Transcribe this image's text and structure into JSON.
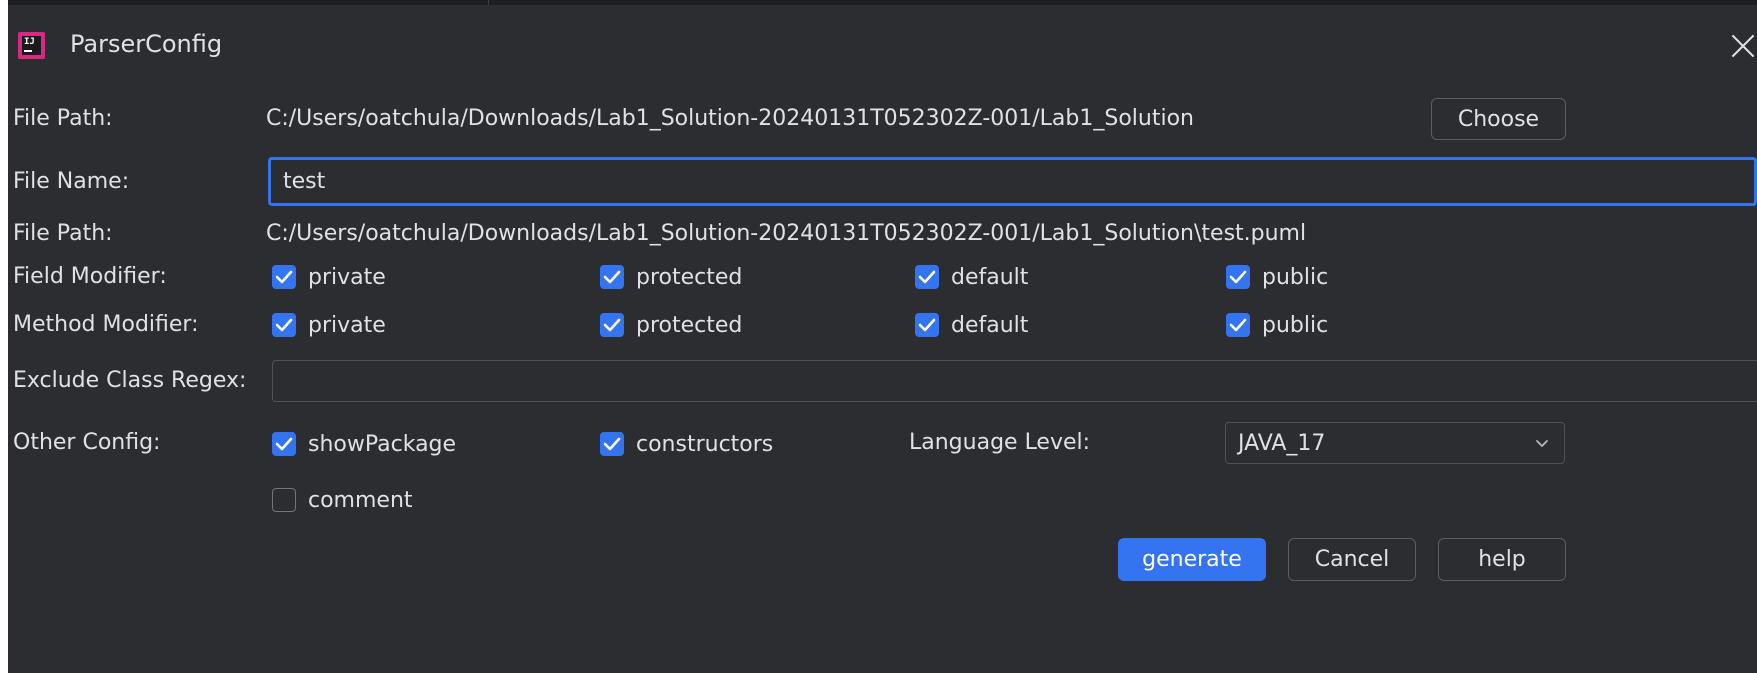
{
  "window": {
    "title": "ParserConfig"
  },
  "form": {
    "file_path_label": "File Path:",
    "file_path_value": "C:/Users/oatchula/Downloads/Lab1_Solution-20240131T052302Z-001/Lab1_Solution",
    "choose_label": "Choose",
    "file_name_label": "File Name:",
    "file_name_value": "test",
    "output_path_label": "File Path:",
    "output_path_value": "C:/Users/oatchula/Downloads/Lab1_Solution-20240131T052302Z-001/Lab1_Solution\\test.puml",
    "field_modifier_label": "Field Modifier:",
    "field_modifiers": [
      {
        "label": "private",
        "checked": true
      },
      {
        "label": "protected",
        "checked": true
      },
      {
        "label": "default",
        "checked": true
      },
      {
        "label": "public",
        "checked": true
      }
    ],
    "method_modifier_label": "Method Modifier:",
    "method_modifiers": [
      {
        "label": "private",
        "checked": true
      },
      {
        "label": "protected",
        "checked": true
      },
      {
        "label": "default",
        "checked": true
      },
      {
        "label": "public",
        "checked": true
      }
    ],
    "exclude_regex_label": "Exclude Class Regex:",
    "exclude_regex_value": "",
    "other_config_label": "Other Config:",
    "other_config": [
      {
        "label": "showPackage",
        "checked": true
      },
      {
        "label": "constructors",
        "checked": true
      },
      {
        "label": "comment",
        "checked": false
      }
    ],
    "language_level_label": "Language Level:",
    "language_level_value": "JAVA_17"
  },
  "buttons": {
    "generate_label": "generate",
    "cancel_label": "Cancel",
    "help_label": "help"
  },
  "colors": {
    "background": "#2b2d30",
    "accent": "#3574f0",
    "text": "#dfe1e5",
    "border": "#4e5157"
  },
  "icons": {
    "app": "intellij-idea-icon",
    "close": "close-icon",
    "check": "checkmark-icon",
    "dropdown": "chevron-down-icon"
  }
}
